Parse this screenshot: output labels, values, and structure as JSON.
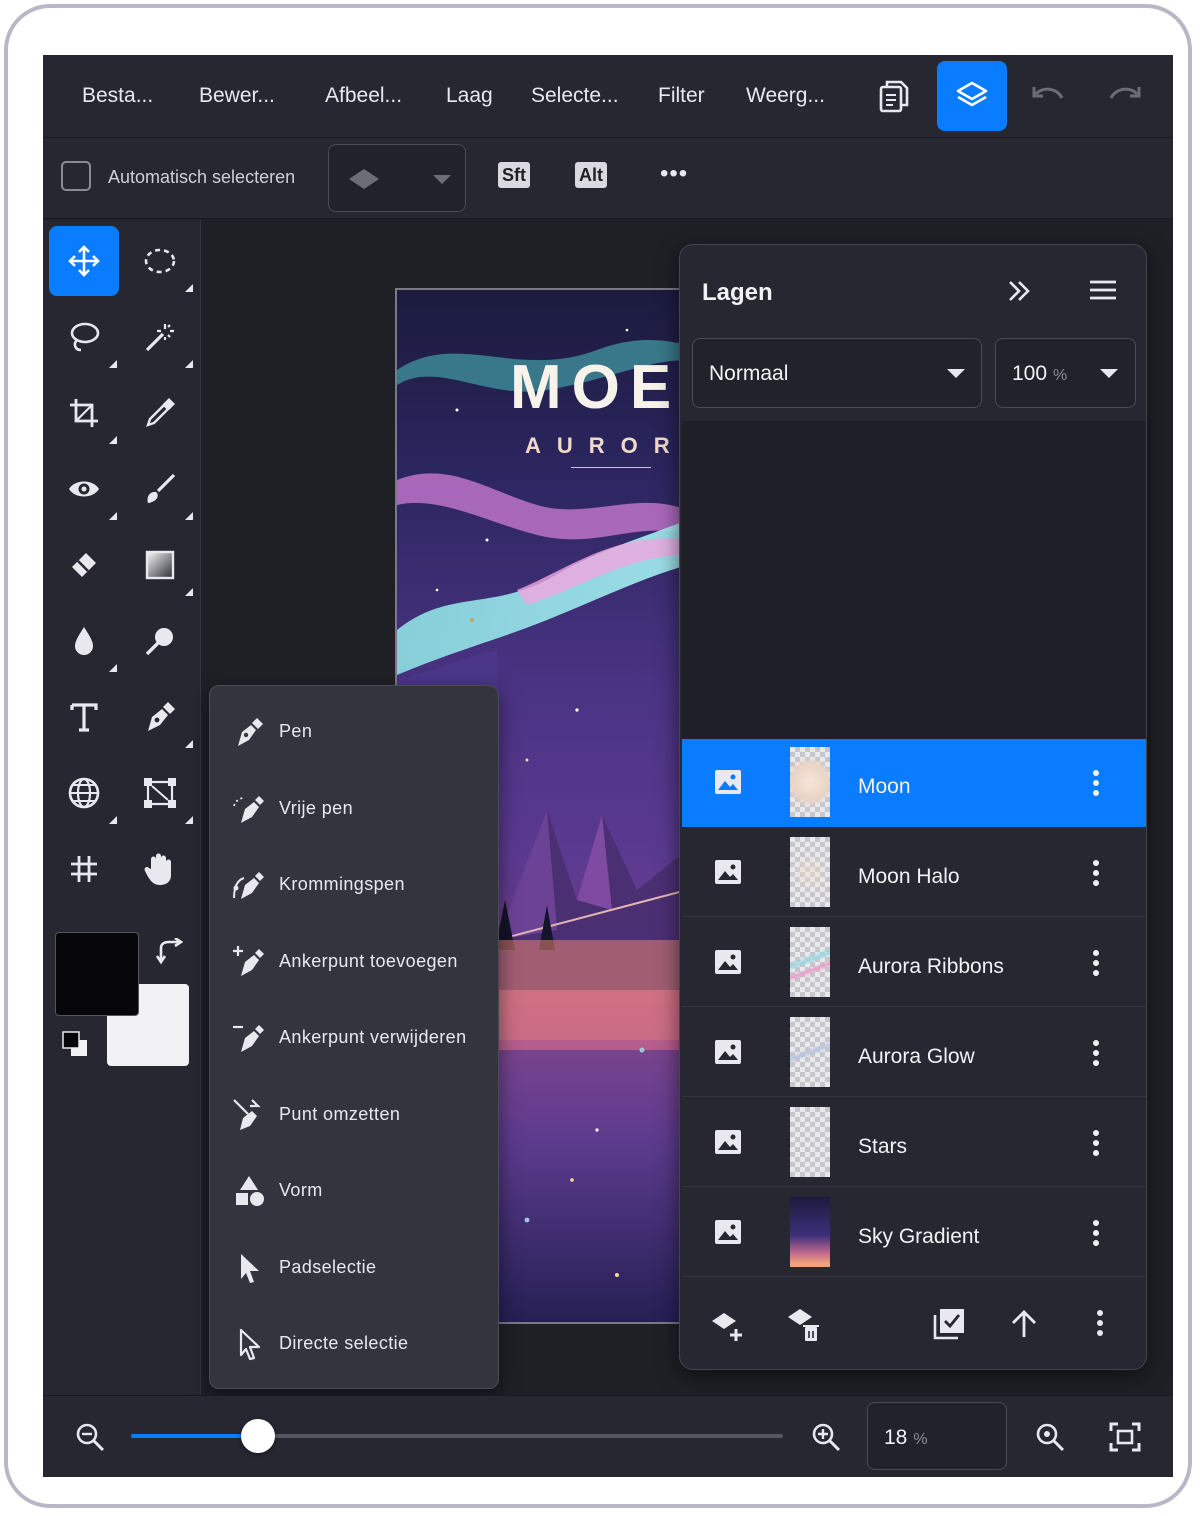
{
  "menu": {
    "items": [
      "Besta...",
      "Bewer...",
      "Afbeel...",
      "Laag",
      "Selecte...",
      "Filter",
      "Weerg..."
    ]
  },
  "options": {
    "auto_select_label": "Automatisch selecteren",
    "auto_select_checked": false,
    "shift_key": "Sft",
    "alt_key": "Alt",
    "more": "•••"
  },
  "canvas": {
    "title": "MOE",
    "subtitle": "AURORA"
  },
  "tool_flyout": {
    "items": [
      {
        "label": "Pen",
        "icon": "pen-icon"
      },
      {
        "label": "Vrije pen",
        "icon": "freeform-pen-icon"
      },
      {
        "label": "Krommingspen",
        "icon": "curvature-pen-icon"
      },
      {
        "label": "Ankerpunt toevoegen",
        "icon": "add-anchor-icon"
      },
      {
        "label": "Ankerpunt verwijderen",
        "icon": "delete-anchor-icon"
      },
      {
        "label": "Punt omzetten",
        "icon": "convert-point-icon"
      },
      {
        "label": "Vorm",
        "icon": "shape-icon"
      },
      {
        "label": "Padselectie",
        "icon": "path-selection-icon"
      },
      {
        "label": "Directe selectie",
        "icon": "direct-selection-icon"
      }
    ]
  },
  "layers_panel": {
    "title": "Lagen",
    "blend_mode": "Normaal",
    "opacity_value": "100",
    "opacity_unit": "%",
    "layers": [
      {
        "name": "Moon",
        "selected": true
      },
      {
        "name": "Moon Halo",
        "selected": false
      },
      {
        "name": "Aurora Ribbons",
        "selected": false
      },
      {
        "name": "Aurora Glow",
        "selected": false
      },
      {
        "name": "Stars",
        "selected": false
      },
      {
        "name": "Sky Gradient",
        "selected": false
      }
    ]
  },
  "zoom": {
    "value": "18",
    "unit": "%",
    "slider_fraction": 0.195
  },
  "colors": {
    "accent": "#0a7cff",
    "foreground_swatch": "#07070a",
    "background_swatch": "#f2f2f4"
  }
}
